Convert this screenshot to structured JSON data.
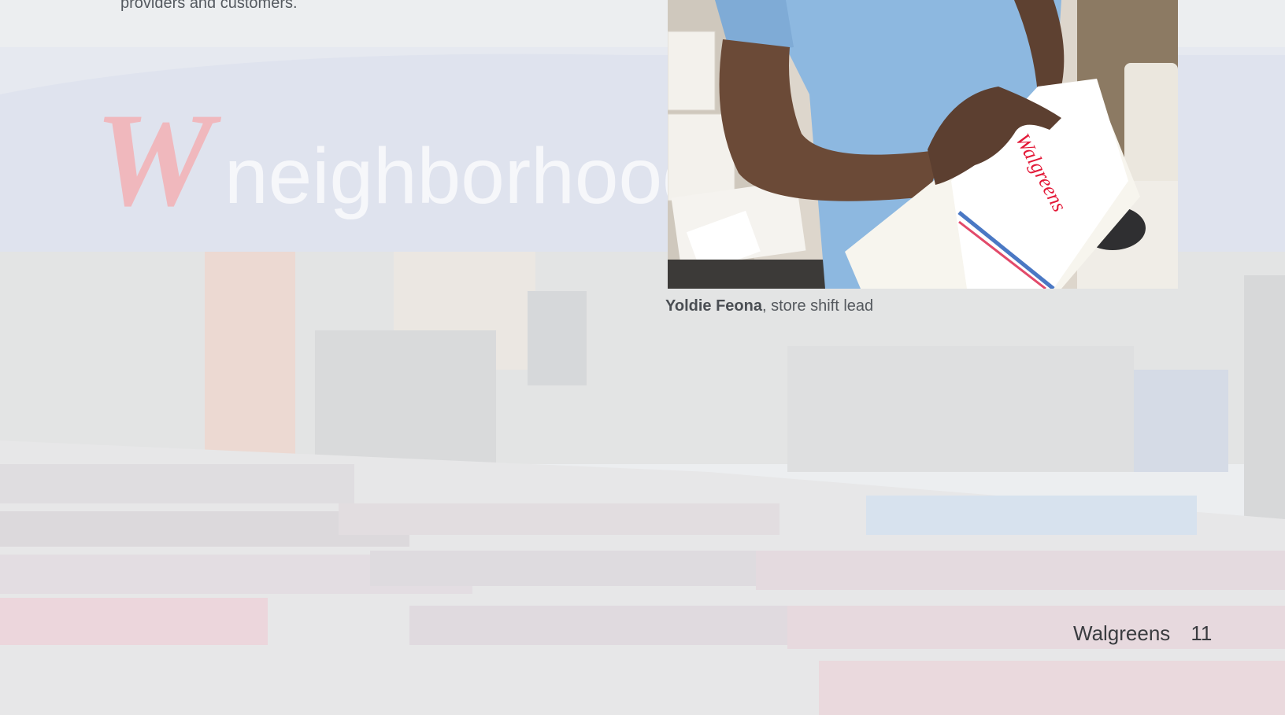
{
  "intro": {
    "text": "providers and customers."
  },
  "background": {
    "signage_word": "neighborhood",
    "logo_letter": "W"
  },
  "photo": {
    "bag_brand": "Walgreens"
  },
  "caption": {
    "name": "Yoldie Feona",
    "role": ", store shift lead"
  },
  "footer": {
    "brand": "Walgreens",
    "page_number": "11"
  },
  "colors": {
    "brand_red": "#e31837",
    "text_gray": "#55595e",
    "scrub_blue": "#8db8e0"
  }
}
